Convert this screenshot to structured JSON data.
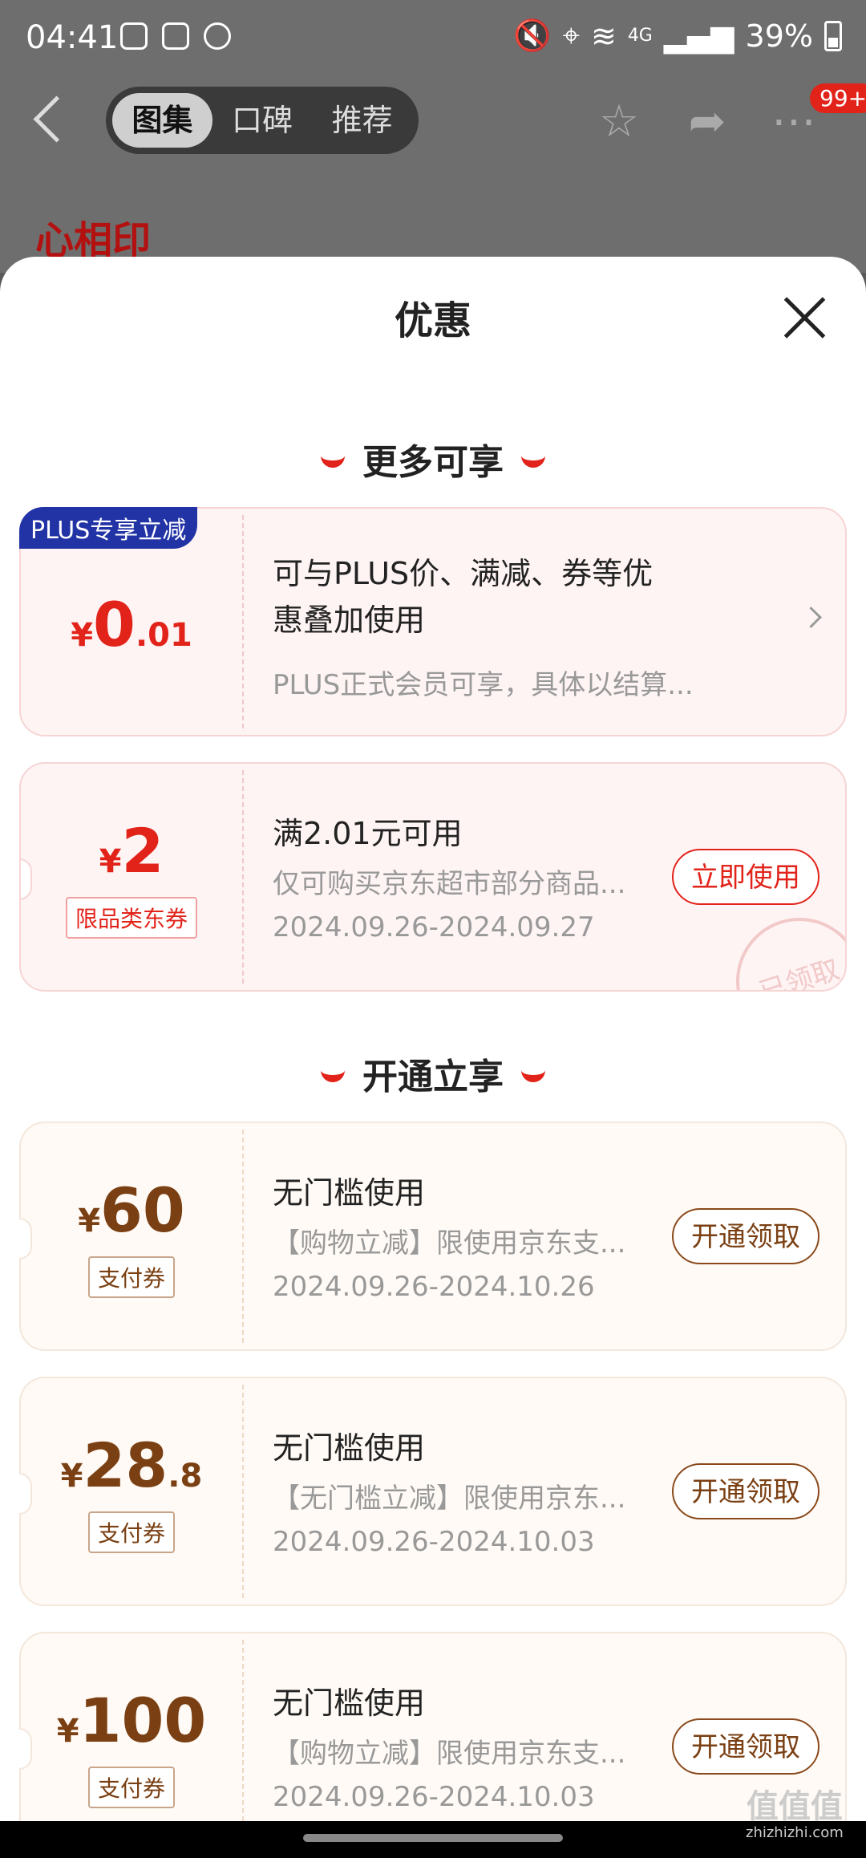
{
  "status": {
    "time": "04:41",
    "battery": "39%",
    "network": "4G"
  },
  "topnav": {
    "tabs": [
      "图集",
      "口碑",
      "推荐"
    ],
    "badge": "99+"
  },
  "hero": {
    "logo": "心相印"
  },
  "sheet": {
    "title": "优惠",
    "section1": "更多可享",
    "section2": "开通立享",
    "plus_card": {
      "badge": "PLUS专享立减",
      "currency": "¥",
      "amount_int": "0",
      "amount_dec": ".01",
      "line1": "可与PLUS价、满减、券等优",
      "line2": "惠叠加使用",
      "desc": "PLUS正式会员可享，具体以结算..."
    },
    "coupon1": {
      "currency": "¥",
      "amount": "2",
      "tag": "限品类东券",
      "title": "满2.01元可用",
      "desc": "仅可购买京东超市部分商品...",
      "date": "2024.09.26-2024.09.27",
      "button": "立即使用",
      "stamp": "已领取"
    },
    "coupon2": {
      "currency": "¥",
      "amount": "60",
      "dec": "",
      "tag": "支付券",
      "title": "无门槛使用",
      "desc": "【购物立减】限使用京东支...",
      "date": "2024.09.26-2024.10.26",
      "button": "开通领取"
    },
    "coupon3": {
      "currency": "¥",
      "amount": "28",
      "dec": ".8",
      "tag": "支付券",
      "title": "无门槛使用",
      "desc": "【无门槛立减】限使用京东...",
      "date": "2024.09.26-2024.10.03",
      "button": "开通领取"
    },
    "coupon4": {
      "currency": "¥",
      "amount": "100",
      "dec": "",
      "tag": "支付券",
      "title": "无门槛使用",
      "desc": "【购物立减】限使用京东支...",
      "date": "2024.09.26-2024.10.03",
      "button": "开通领取"
    }
  },
  "watermark": {
    "text": "值值值",
    "sub": "zhizhizhi.com"
  }
}
